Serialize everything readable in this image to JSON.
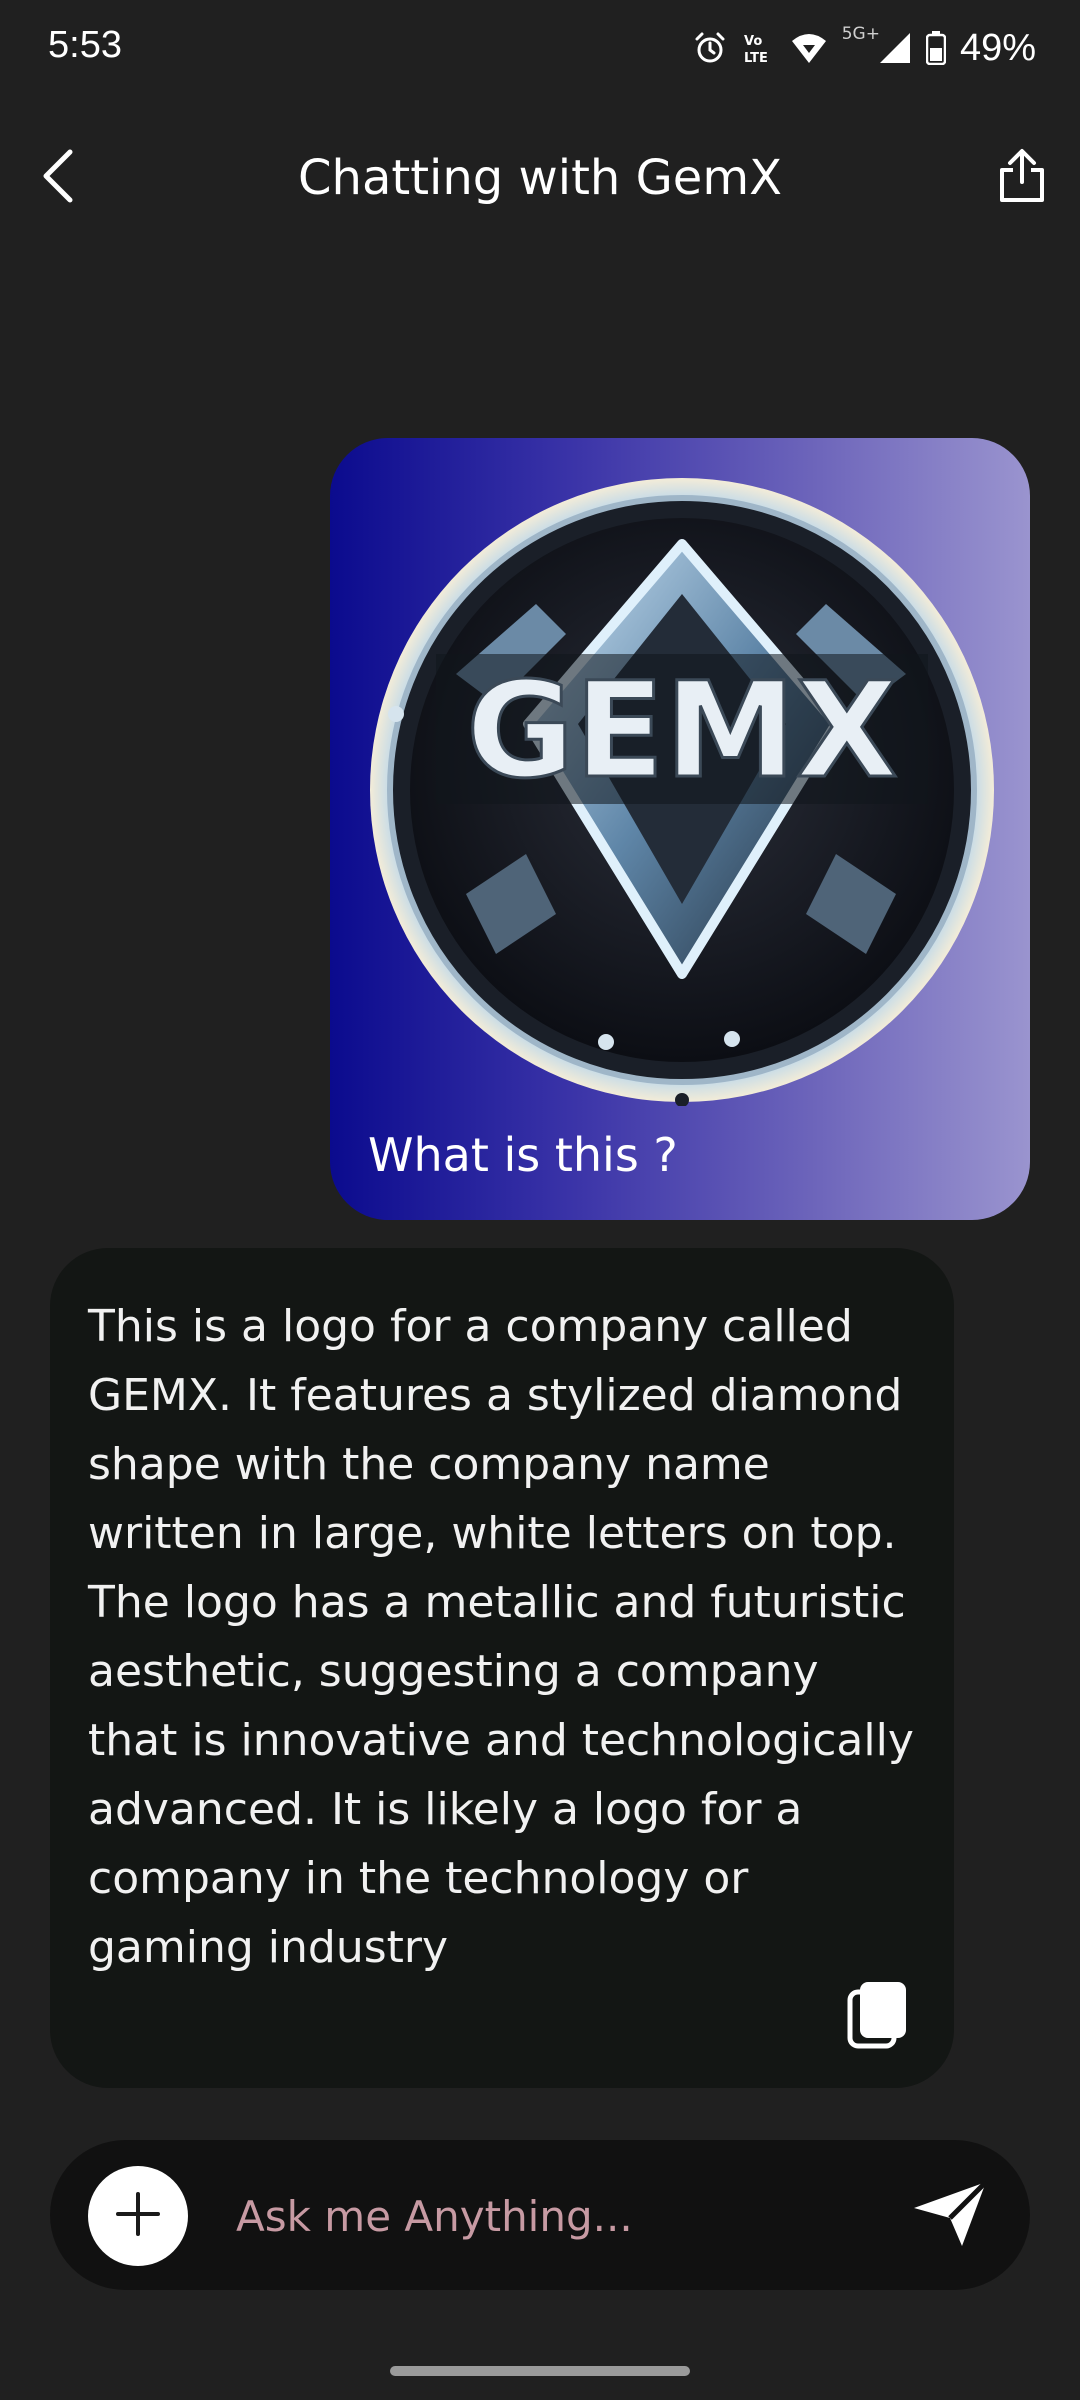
{
  "status_bar": {
    "time": "5:53",
    "network": "5G+",
    "battery": "49%",
    "icons": [
      "alarm-icon",
      "volte-icon",
      "wifi-icon",
      "signal-icon",
      "battery-icon"
    ]
  },
  "header": {
    "title": "Chatting with GemX",
    "back_icon": "chevron-left-icon",
    "share_icon": "share-icon"
  },
  "messages": {
    "user": {
      "image_logo_text": "GEMX",
      "text": "What is this ?"
    },
    "bot": {
      "text": "This is a logo for a company called GEMX. It features a stylized diamond shape with the company name written in large, white letters on top. The logo has a metallic and futuristic aesthetic, suggesting a company that is innovative and technologically advanced. It is likely a logo for a company in the technology or gaming industry",
      "copy_icon": "copy-icon"
    }
  },
  "input": {
    "placeholder": "Ask me Anything...",
    "value": ""
  },
  "colors": {
    "background": "#202020",
    "bot_bubble": "#131614",
    "user_gradient_start": "#0b0b8e",
    "user_gradient_end": "#9a94cf",
    "placeholder": "#c79aa3"
  }
}
